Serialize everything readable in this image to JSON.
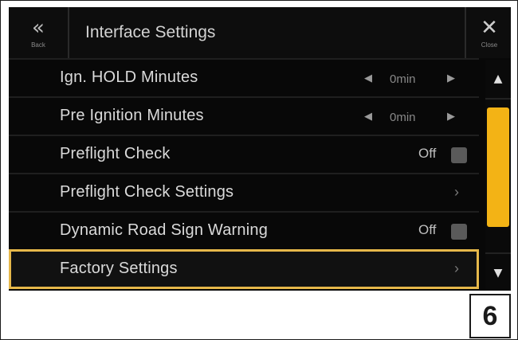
{
  "header": {
    "back_label": "Back",
    "title": "Interface Settings",
    "close_label": "Close"
  },
  "rows": [
    {
      "label": "Ign. HOLD Minutes",
      "type": "stepper",
      "value": "0min"
    },
    {
      "label": "Pre Ignition Minutes",
      "type": "stepper",
      "value": "0min"
    },
    {
      "label": "Preflight Check",
      "type": "toggle",
      "value": "Off"
    },
    {
      "label": "Preflight Check Settings",
      "type": "link"
    },
    {
      "label": "Dynamic Road Sign Warning",
      "type": "toggle",
      "value": "Off"
    },
    {
      "label": "Factory Settings",
      "type": "link",
      "selected": true
    }
  ],
  "icons": {
    "back": "double-chevron-left-icon",
    "close": "close-x-icon",
    "step_left": "triangle-left-icon",
    "step_right": "triangle-right-icon",
    "chevron": "chevron-right-icon",
    "scroll_up": "triangle-up-icon",
    "scroll_down": "triangle-down-icon"
  },
  "colors": {
    "highlight": "#e6b84a",
    "scroll_thumb": "#f3b315",
    "background": "#080808"
  },
  "page_number": "6"
}
